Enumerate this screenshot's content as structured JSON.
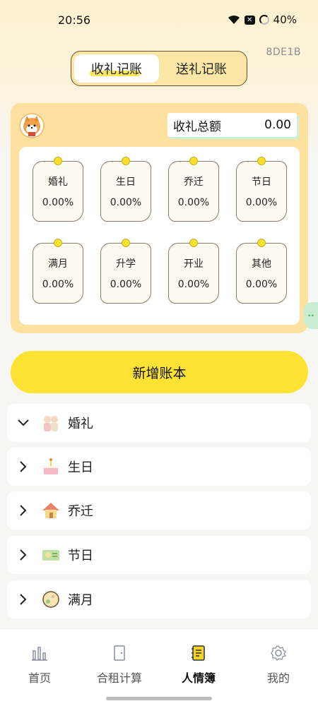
{
  "status": {
    "time": "20:56",
    "battery": "40%",
    "notif_badge": "✕"
  },
  "page_code": "8DE1B",
  "tabs": [
    {
      "label": "收礼记账",
      "active": true
    },
    {
      "label": "送礼记账",
      "active": false
    }
  ],
  "summary": {
    "total_label": "收礼总额",
    "total_value": "0.00"
  },
  "categories_grid": [
    {
      "label": "婚礼",
      "value": "0.00%"
    },
    {
      "label": "生日",
      "value": "0.00%"
    },
    {
      "label": "乔迁",
      "value": "0.00%"
    },
    {
      "label": "节日",
      "value": "0.00%"
    },
    {
      "label": "满月",
      "value": "0.00%"
    },
    {
      "label": "升学",
      "value": "0.00%"
    },
    {
      "label": "开业",
      "value": "0.00%"
    },
    {
      "label": "其他",
      "value": "0.00%"
    }
  ],
  "new_book_label": "新增账本",
  "category_list": [
    {
      "label": "婚礼",
      "icon": "wedding-couple-icon",
      "expanded": true
    },
    {
      "label": "生日",
      "icon": "birthday-cake-icon",
      "expanded": false
    },
    {
      "label": "乔迁",
      "icon": "house-icon",
      "expanded": false
    },
    {
      "label": "节日",
      "icon": "festival-ticket-icon",
      "expanded": false
    },
    {
      "label": "满月",
      "icon": "baby-moon-icon",
      "expanded": false
    }
  ],
  "bottom_nav": [
    {
      "label": "首页",
      "icon": "bar-chart-icon",
      "active": false
    },
    {
      "label": "合租计算",
      "icon": "door-icon",
      "active": false
    },
    {
      "label": "人情簿",
      "icon": "notebook-icon",
      "active": true
    },
    {
      "label": "我的",
      "icon": "gear-icon",
      "active": false
    }
  ],
  "colors": {
    "accent_yellow": "#fee334",
    "card_bg": "#fde19f",
    "tab_border": "#6b5130"
  }
}
